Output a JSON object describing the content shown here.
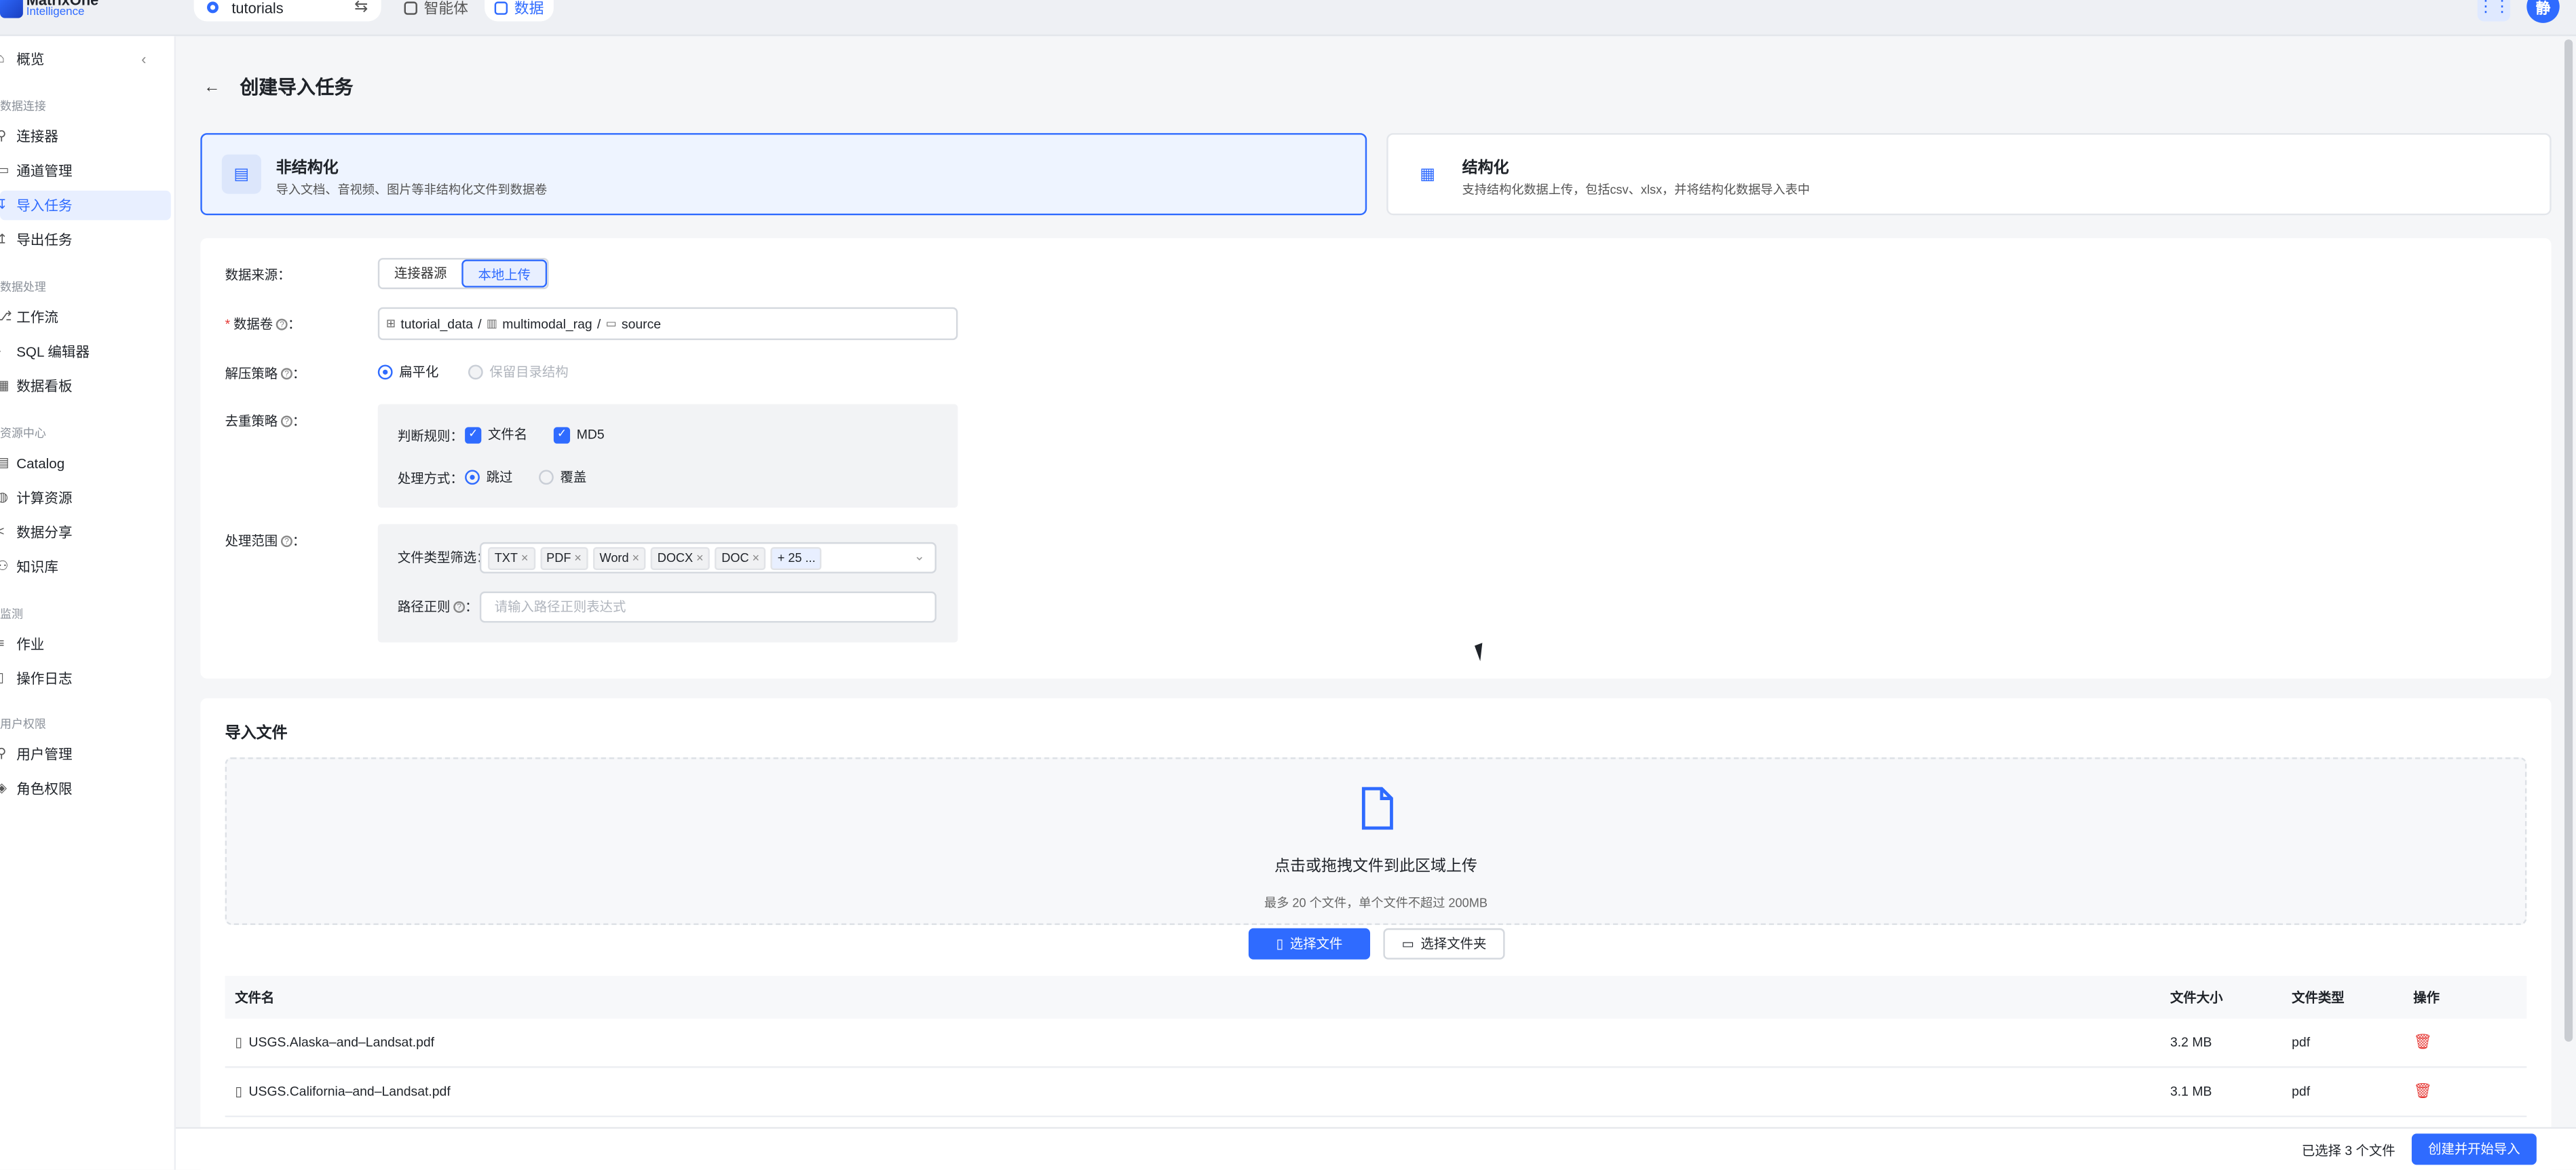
{
  "brand": {
    "name_line1": "MatrixOne",
    "name_line2": "Intelligence"
  },
  "workspace": {
    "name": "tutorials",
    "switch_icon": "swap-icon"
  },
  "topnav": [
    {
      "label": "智能体",
      "active": false
    },
    {
      "label": "数据",
      "active": true
    }
  ],
  "user": {
    "avatar_initial": "静"
  },
  "sidebar": {
    "overview": "概览",
    "groups": [
      {
        "title": "数据连接",
        "items": [
          "连接器",
          "通道管理",
          "导入任务",
          "导出任务"
        ]
      },
      {
        "title": "数据处理",
        "items": [
          "工作流",
          "SQL 编辑器",
          "数据看板"
        ]
      },
      {
        "title": "资源中心",
        "items": [
          "Catalog",
          "计算资源",
          "数据分享",
          "知识库"
        ]
      },
      {
        "title": "监测",
        "items": [
          "作业",
          "操作日志"
        ]
      },
      {
        "title": "用户权限",
        "items": [
          "用户管理",
          "角色权限"
        ]
      }
    ],
    "active_item": "导入任务"
  },
  "page": {
    "title": "创建导入任务"
  },
  "types": {
    "unstructured": {
      "title": "非结构化",
      "desc": "导入文档、音视频、图片等非结构化文件到数据卷"
    },
    "structured": {
      "title": "结构化",
      "desc": "支持结构化数据上传，包括csv、xlsx，并将结构化数据导入表中"
    }
  },
  "form": {
    "source_label": "数据来源：",
    "source_options": [
      "连接器源",
      "本地上传"
    ],
    "volume_label": "数据卷",
    "volume_path": [
      "tutorial_data",
      "multimodal_rag",
      "source"
    ],
    "path_sep": "/",
    "unzip_label": "解压策略",
    "unzip_options": [
      "扁平化",
      "保留目录结构"
    ],
    "dedup_label": "去重策略",
    "rule_label": "判断规则：",
    "rule_options": [
      "文件名",
      "MD5"
    ],
    "mode_label": "处理方式：",
    "mode_options": [
      "跳过",
      "覆盖"
    ],
    "scope_label": "处理范围",
    "filetype_label": "文件类型筛选：",
    "filetype_tags": [
      "TXT",
      "PDF",
      "Word",
      "DOCX",
      "DOC"
    ],
    "filetype_more": "+ 25 ...",
    "regex_label": "路径正则",
    "regex_placeholder": "请输入路径正则表达式",
    "colon": "："
  },
  "import_files": {
    "title": "导入文件",
    "drop_title": "点击或拖拽文件到此区域上传",
    "drop_hint": "最多 20 个文件，单个文件不超过 200MB",
    "choose_file": "选择文件",
    "choose_folder": "选择文件夹",
    "columns": [
      "文件名",
      "文件大小",
      "文件类型",
      "操作"
    ],
    "rows": [
      {
        "name": "USGS.Alaska–and–Landsat.pdf",
        "size": "3.2 MB",
        "type": "pdf"
      },
      {
        "name": "USGS.California–and–Landsat.pdf",
        "size": "3.1 MB",
        "type": "pdf"
      }
    ]
  },
  "footer": {
    "selected": "已选择 3 个文件",
    "submit": "创建并开始导入"
  },
  "colors": {
    "accent": "#2f6bff",
    "danger": "#e53935"
  }
}
